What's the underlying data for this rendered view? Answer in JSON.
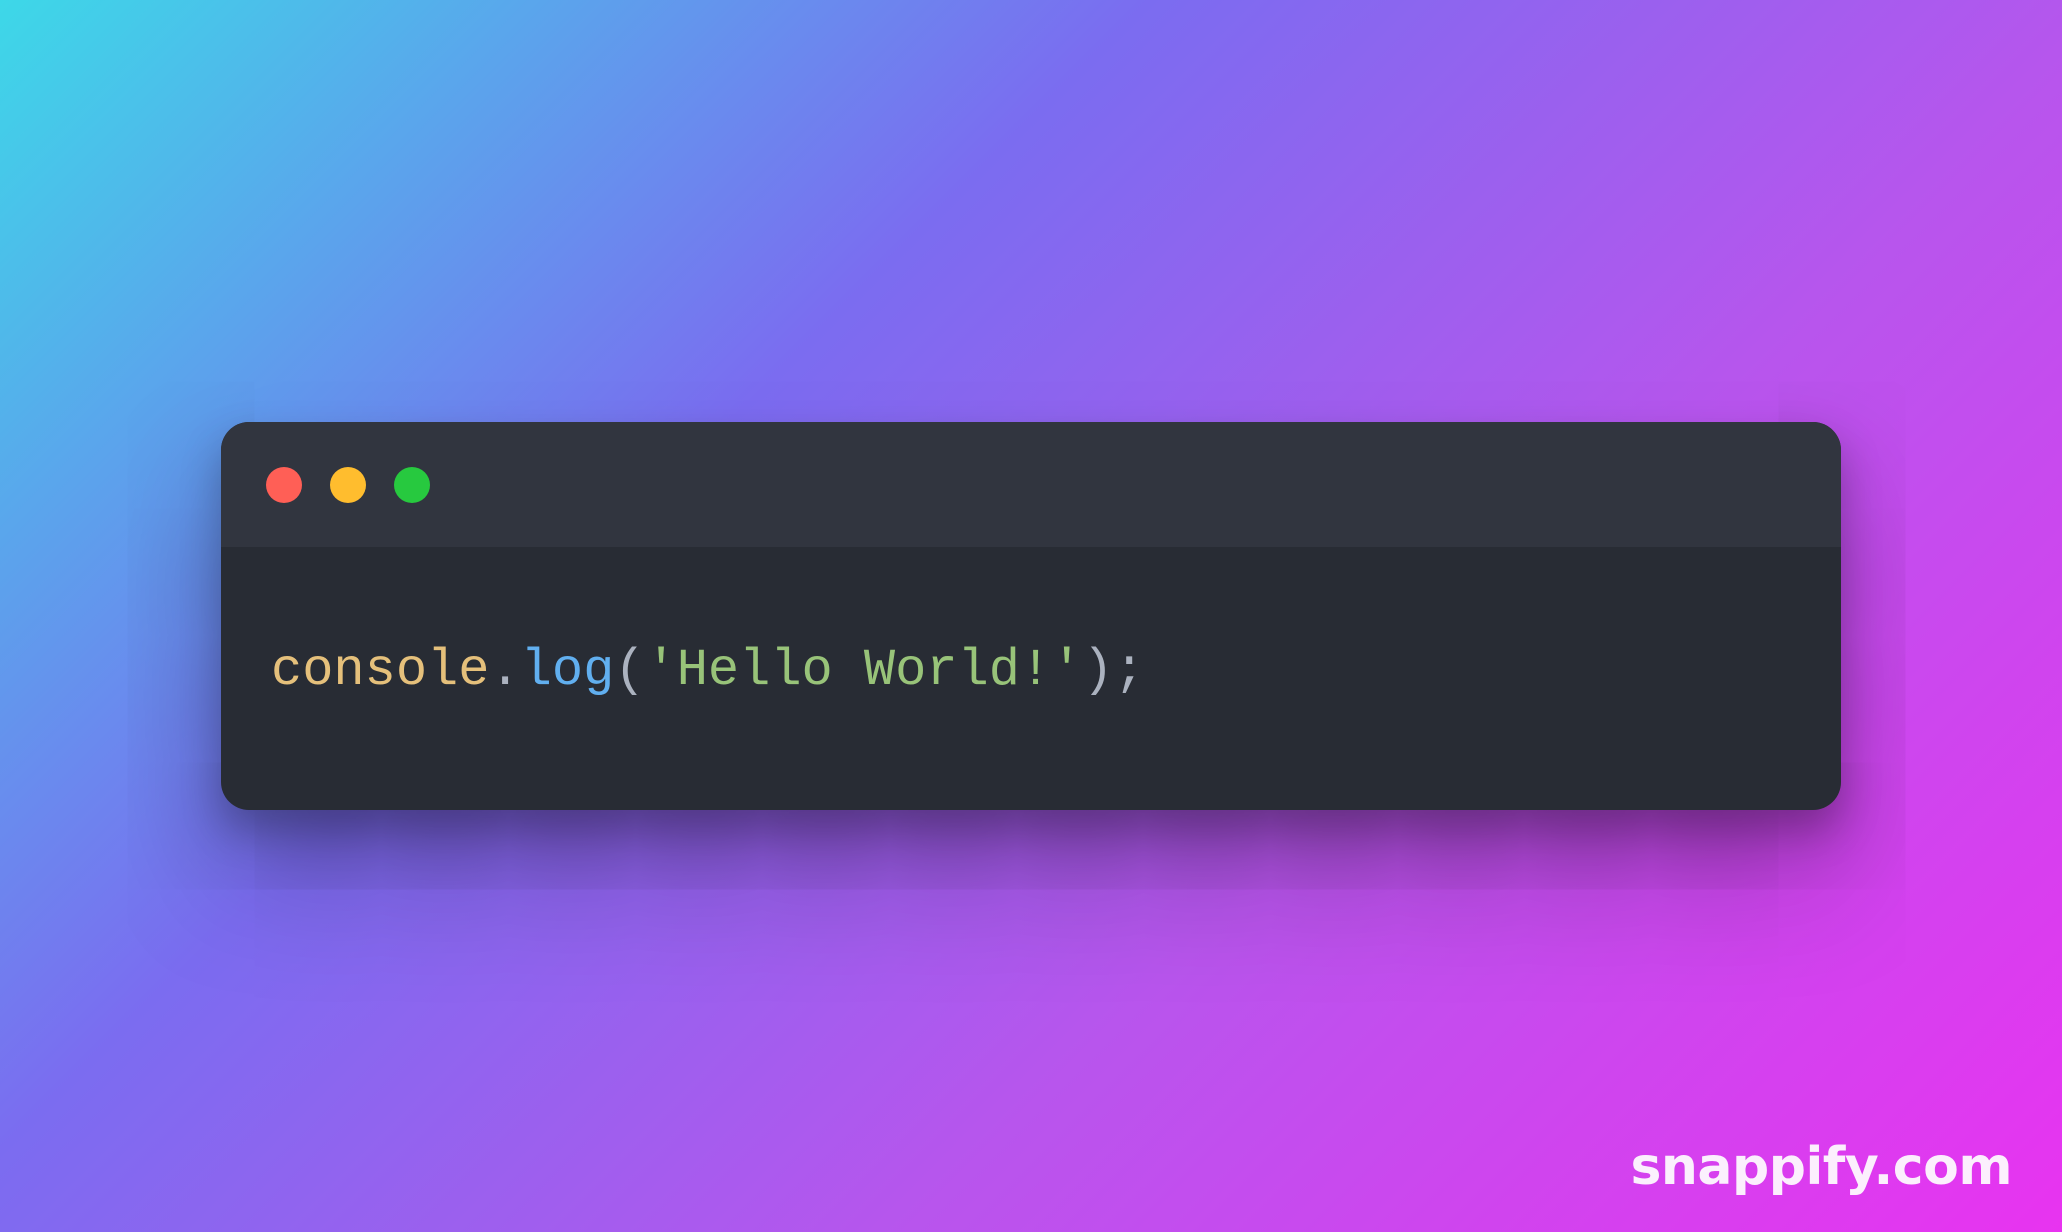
{
  "window": {
    "traffic_lights": {
      "red": "#ff5f56",
      "yellow": "#ffbd2e",
      "green": "#27c93f"
    }
  },
  "code": {
    "tokens": {
      "object": "console",
      "dot": ".",
      "method": "log",
      "open_paren": "(",
      "string": "'Hello World!'",
      "close_paren": ")",
      "semicolon": ";"
    }
  },
  "watermark": "snappify.com",
  "colors": {
    "window_bg": "#282c34",
    "titlebar_bg": "#31353f",
    "token_object": "#e5c07b",
    "token_punctuation": "#abb2bf",
    "token_method": "#61afef",
    "token_string": "#98c379"
  }
}
